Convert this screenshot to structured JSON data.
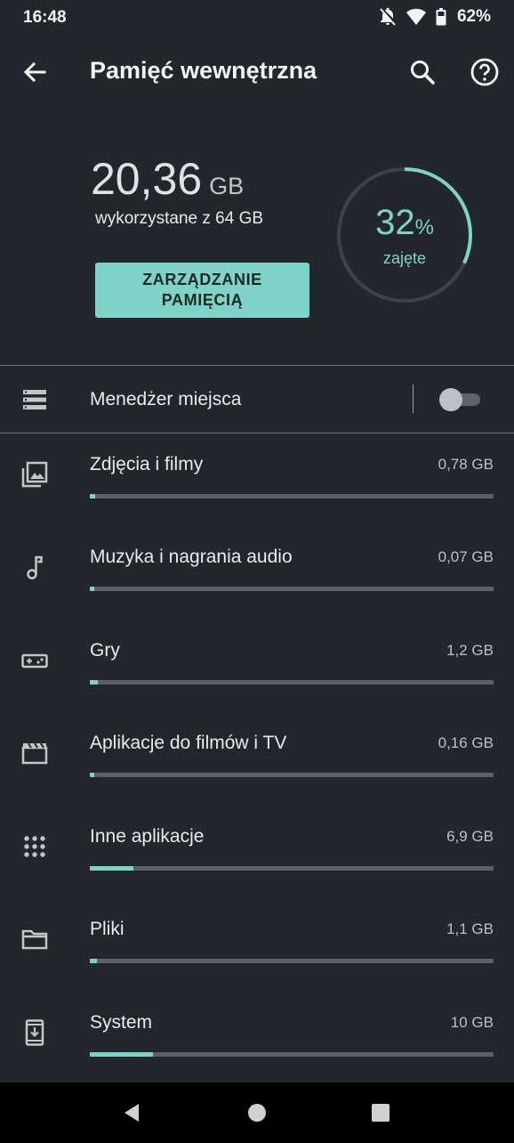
{
  "status_bar": {
    "time": "16:48",
    "battery": "62%",
    "icons": [
      "bell-off-icon",
      "wifi-icon",
      "battery-icon"
    ]
  },
  "app_bar": {
    "title": "Pamięć wewnętrzna",
    "icons": [
      "back-arrow-icon",
      "search-icon",
      "help-icon"
    ]
  },
  "summary": {
    "used_value": "20,36",
    "used_unit": "GB",
    "used_of_text": "wykorzystane z 64 GB",
    "manage_button_line1": "ZARZĄDZANIE",
    "manage_button_line2": "PAMIĘCIĄ",
    "percent_number": "32",
    "percent_symbol": "%",
    "percent_used": 0.32,
    "percent_label": "zajęte"
  },
  "storage_manager": {
    "label": "Menedżer miejsca",
    "toggle_on": false
  },
  "categories": [
    {
      "name": "Zdjęcia i filmy",
      "size": "0,78 GB",
      "fraction": 0.0122,
      "icon": "photo-icon"
    },
    {
      "name": "Muzyka i nagrania audio",
      "size": "0,07 GB",
      "fraction": 0.0011,
      "icon": "music-note-icon"
    },
    {
      "name": "Gry",
      "size": "1,2 GB",
      "fraction": 0.0188,
      "icon": "gamepad-icon"
    },
    {
      "name": "Aplikacje do filmów i TV",
      "size": "0,16 GB",
      "fraction": 0.0025,
      "icon": "movie-icon"
    },
    {
      "name": "Inne aplikacje",
      "size": "6,9 GB",
      "fraction": 0.1078,
      "icon": "apps-grid-icon"
    },
    {
      "name": "Pliki",
      "size": "1,1 GB",
      "fraction": 0.0172,
      "icon": "folder-icon"
    },
    {
      "name": "System",
      "size": "10 GB",
      "fraction": 0.15625,
      "icon": "system-update-icon"
    }
  ],
  "colors": {
    "background": "#23272b",
    "accent": "#7ed2c8",
    "track": "#5b6065"
  }
}
